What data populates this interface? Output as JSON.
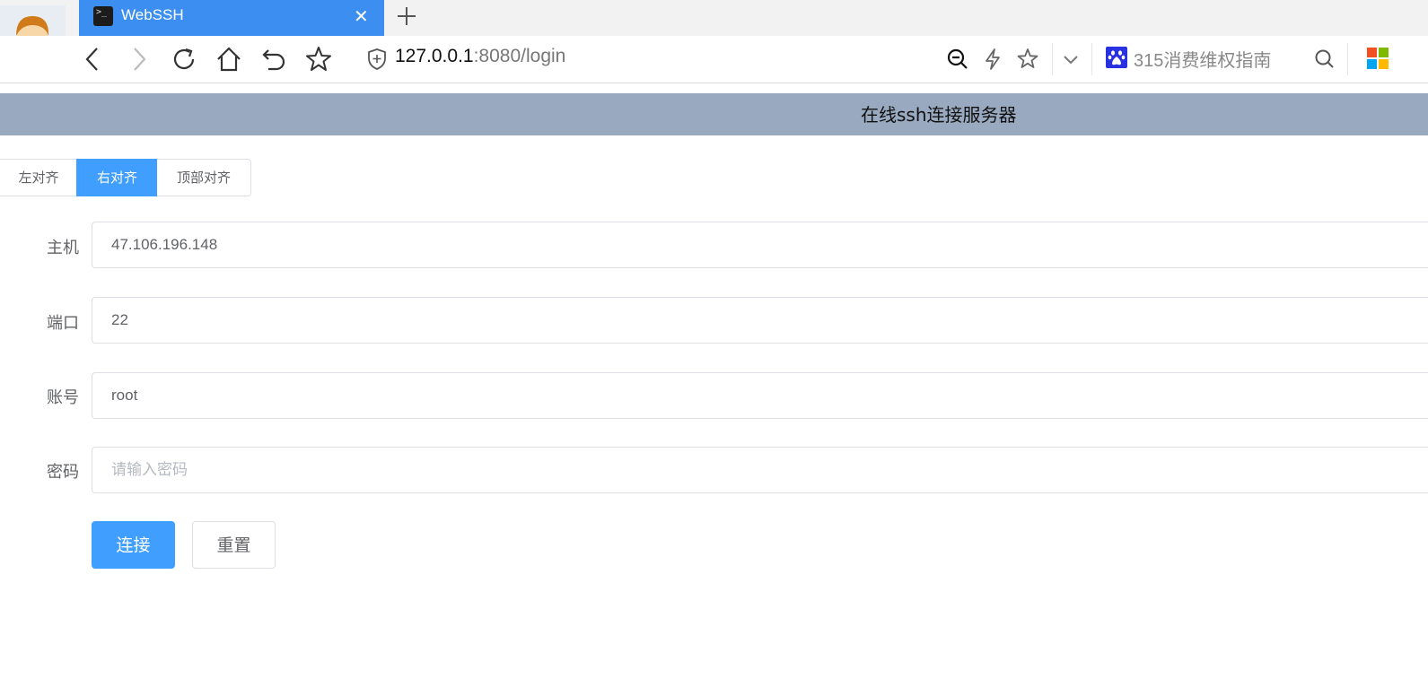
{
  "browser": {
    "tab_title": "WebSSH",
    "tab_favicon_text": ">_",
    "url_host": "127.0.0.1",
    "url_rest": ":8080/login",
    "search_hint": "315消费维权指南"
  },
  "header": {
    "title": "在线ssh连接服务器"
  },
  "align_group": {
    "options": [
      "左对齐",
      "右对齐",
      "顶部对齐"
    ],
    "selected": "右对齐"
  },
  "form": {
    "host": {
      "label": "主机",
      "value": "47.106.196.148"
    },
    "port": {
      "label": "端口",
      "value": "22"
    },
    "account": {
      "label": "账号",
      "value": "root"
    },
    "password": {
      "label": "密码",
      "value": "",
      "placeholder": "请输入密码"
    }
  },
  "buttons": {
    "connect": "连接",
    "reset": "重置"
  },
  "colors": {
    "primary": "#409eff",
    "header_bg": "#99a9bf",
    "tab_bg": "#3c8ff0"
  }
}
